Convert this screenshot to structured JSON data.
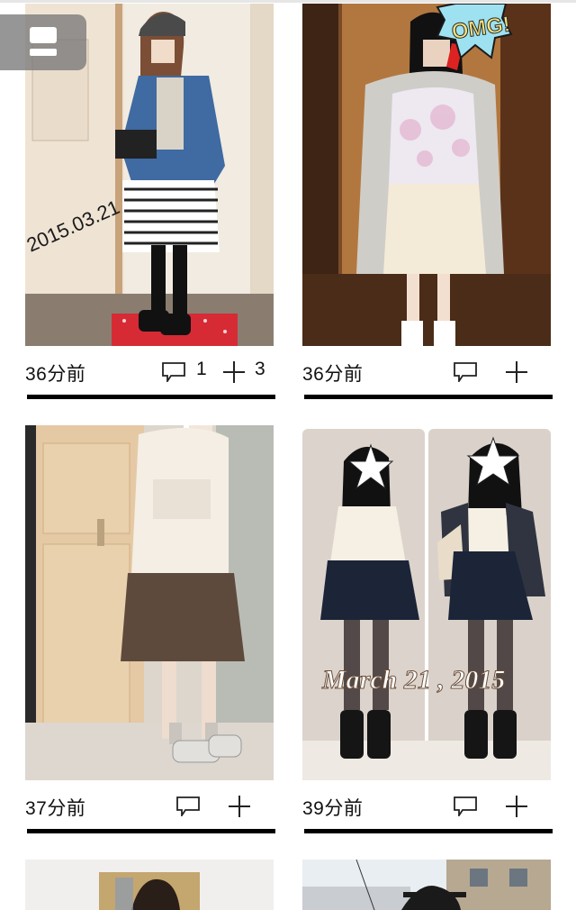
{
  "cards": [
    {
      "time": "36分前",
      "comments": "1",
      "likes": "3",
      "stamp": "2015.03.21"
    },
    {
      "time": "36分前",
      "comments": "",
      "likes": "",
      "stamp": "OMG!"
    },
    {
      "time": "37分前",
      "comments": "",
      "likes": ""
    },
    {
      "time": "39分前",
      "comments": "",
      "likes": "",
      "stamp": "March 21 , 2015"
    }
  ],
  "icons": {
    "menu": "menu-icon",
    "comment": "comment-icon",
    "add": "plus-icon"
  }
}
